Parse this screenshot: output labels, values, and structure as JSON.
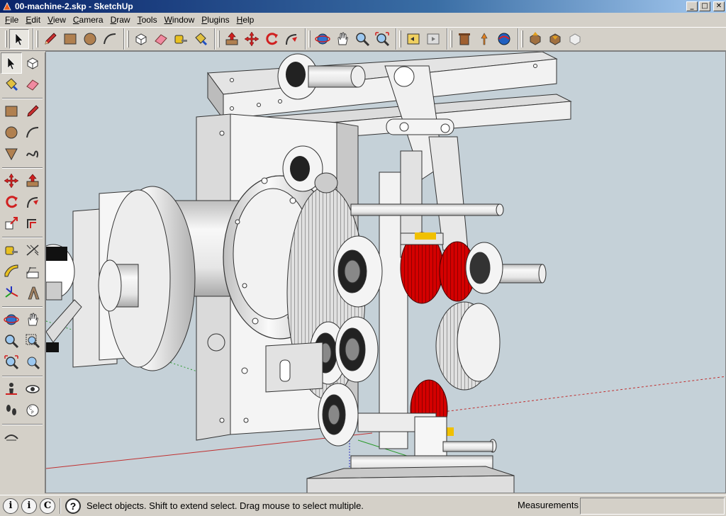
{
  "window": {
    "title": "00-machine-2.skp - SketchUp"
  },
  "titlebar_buttons": {
    "minimize": "_",
    "maximize": "□",
    "close": "✕"
  },
  "menu": [
    {
      "key": "F",
      "rest": "ile"
    },
    {
      "key": "E",
      "rest": "dit"
    },
    {
      "key": "V",
      "rest": "iew"
    },
    {
      "key": "C",
      "rest": "amera"
    },
    {
      "key": "D",
      "rest": "raw"
    },
    {
      "key": "T",
      "rest": "ools"
    },
    {
      "key": "W",
      "rest": "indow"
    },
    {
      "key": "P",
      "rest": "lugins"
    },
    {
      "key": "H",
      "rest": "elp"
    }
  ],
  "toolbar": {
    "active_tool": "select-icon",
    "groups": [
      [
        "select-icon"
      ],
      [
        "pencil-icon",
        "rectangle-icon",
        "circle-icon",
        "arc-icon"
      ],
      [
        "make-component-icon",
        "eraser-icon",
        "tape-measure-icon",
        "paint-bucket-icon"
      ],
      [
        "push-pull-icon",
        "move-icon",
        "rotate-icon",
        "follow-me-icon"
      ],
      [
        "orbit-icon",
        "pan-icon",
        "zoom-icon",
        "zoom-extents-icon"
      ],
      [
        "previous-view-icon",
        "next-view-icon"
      ],
      [
        "add-location-icon",
        "toggle-terrain-icon",
        "get-models-icon"
      ],
      [
        "share-model-icon",
        "get-components-icon",
        "share-component-icon"
      ]
    ]
  },
  "left_toolbar": {
    "rows": [
      [
        "select-icon",
        "make-component-icon"
      ],
      [
        "paint-bucket-icon",
        "eraser-icon"
      ],
      "sep",
      [
        "rectangle-icon",
        "line-icon"
      ],
      [
        "circle-icon",
        "arc-icon"
      ],
      [
        "polygon-icon",
        "freehand-icon"
      ],
      "sep",
      [
        "move-icon",
        "push-pull-icon"
      ],
      [
        "rotate-icon",
        "follow-me-icon"
      ],
      [
        "scale-icon",
        "offset-icon"
      ],
      "sep",
      [
        "tape-measure-icon",
        "dimension-icon"
      ],
      [
        "protractor-icon",
        "text-icon"
      ],
      [
        "axes-icon",
        "3d-text-icon"
      ],
      "sep",
      [
        "orbit-icon",
        "pan-icon"
      ],
      [
        "zoom-icon",
        "zoom-window-icon"
      ],
      [
        "zoom-extents-icon",
        "previous-icon"
      ],
      "sep",
      [
        "position-camera-icon",
        "look-around-icon"
      ],
      [
        "walk-icon",
        "section-plane-icon"
      ],
      "sep",
      [
        "sandbox-icon"
      ]
    ]
  },
  "status": {
    "icon1": "i",
    "icon2": "i",
    "icon3": "C",
    "help": "?",
    "message": "Select objects. Shift to extend select. Drag mouse to select multiple.",
    "measurements_label": "Measurements",
    "measurements_value": ""
  },
  "colors": {
    "gear_red": "#cc0000",
    "viewport_bg": "#c5d1d8",
    "title_blue": "#0a246a"
  }
}
